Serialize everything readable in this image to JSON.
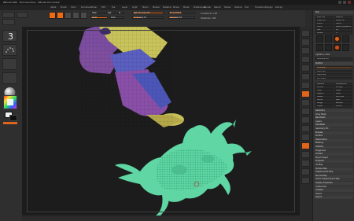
{
  "titlebar": {
    "title": "ZBrush 4R6 · Tool Gnumbus · ZBrush Document",
    "stats": "Active Mesh 4,8,3  Free Mem 2.2 GB  Active Points 1.2M  Total Points 1.6M"
  },
  "menu": [
    "Alpha",
    "Brush",
    "Color",
    "Document",
    "Draw",
    "Edit",
    "File",
    "Layer",
    "Light",
    "Macro",
    "Marker",
    "Material",
    "Movie",
    "Picker",
    "Preferences",
    "Render",
    "Stencil",
    "Stroke",
    "Texture",
    "Tool",
    "Transform",
    "Zplugin",
    "Zscript"
  ],
  "shelf": {
    "buttons": [
      {
        "name": "edit-button",
        "on": true
      },
      {
        "name": "draw-button",
        "on": true
      },
      {
        "name": "move-button",
        "on": false
      },
      {
        "name": "scale-button",
        "on": false
      },
      {
        "name": "rotate-button",
        "on": false
      }
    ],
    "mrgb_label": "Mrgb",
    "rgb_label": "Rgb",
    "m_label": "M",
    "zadd_label": "Zadd",
    "zsub_label": "Zsub",
    "focal_label": "Focal Shift 0",
    "z_intensity_label": "Z Intensity 25",
    "draw_size_label": "Draw Size 64",
    "rgb_intensity_label": "Rgb Intensity 100",
    "active_points": "ActivePoints: 1.2M",
    "total_points": "TotalPoints: 1.6M"
  },
  "leftshelf": {
    "labels": [
      "Projection Master",
      "LightBox",
      "Quick Sketch"
    ]
  },
  "rightcol": {
    "icons": [
      "bpr-icon",
      "spix-icon",
      "scroll-icon",
      "zoom-icon",
      "actual-icon",
      "aahalf-icon",
      "persp-icon",
      "floor-icon",
      "local-icon",
      "xyz-icon",
      "frame-icon",
      "move-icon",
      "scale-icon",
      "rotate-icon",
      "polyf-icon",
      "transp-icon",
      "solo-icon",
      "xpose-icon"
    ]
  },
  "palette": {
    "header": "Tool",
    "top_buttons": [
      "Load Tool",
      "Save As",
      "Copy Tool",
      "Paste Tool",
      "Import",
      "Export",
      "Clone",
      "Make PolyMesh3D",
      "GoZ",
      "All",
      "Visible",
      "R"
    ],
    "lightbox_label": "Lightbox ▸ Tools",
    "current_tool": "Gnumbus. 48",
    "subtool_header": "SubTool",
    "subtools": [
      "Gnumbus",
      "Body_Left",
      "PolyGroup",
      "Arm_Right"
    ],
    "sections": [
      "Geometry",
      "Array Mesh",
      "NanoMesh",
      "Layers",
      "FiberMesh",
      "Geometry HD",
      "Preview",
      "Surface",
      "Deformation",
      "Masking",
      "Visibility",
      "Polygroups",
      "Contact",
      "Morph Target",
      "Polypaint",
      "UV Map",
      "Texture Map",
      "Displacement Map",
      "Normal Map",
      "Vector Displacement Map",
      "Display Properties",
      "Unified Skin",
      "Initialize",
      "Import",
      "Export"
    ],
    "footer": [
      "Rename",
      "AutoReorder",
      "All Low",
      "All High",
      "Copy",
      "Paste",
      "Append",
      "Insert",
      "Delete",
      "Del Other",
      "Del All",
      "Split",
      "Merge",
      "Remesh",
      "Project",
      "Extract"
    ]
  },
  "colors": {
    "accent": "#f06a12",
    "model_green": "#5fd6a4",
    "model_purple": "#7f4ea3",
    "model_yellow": "#c8c35a"
  }
}
